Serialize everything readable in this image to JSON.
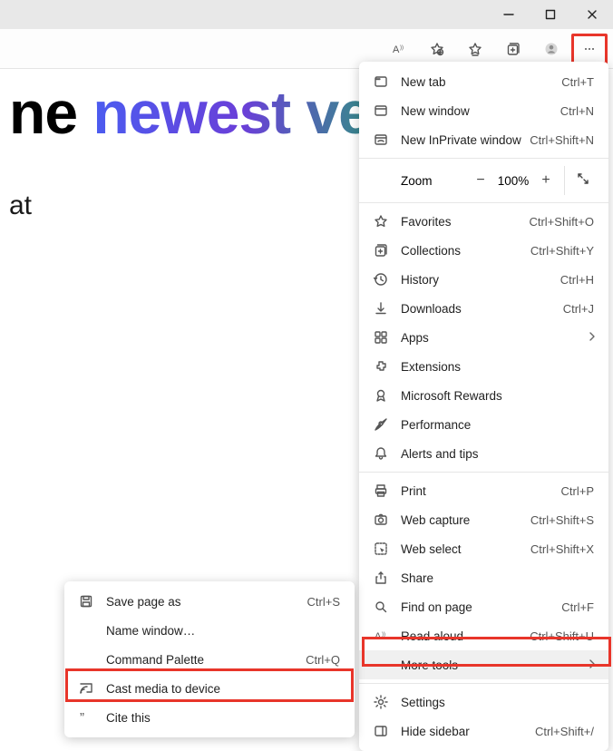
{
  "window": {
    "min": "−",
    "max": "▢",
    "close": "✕"
  },
  "page": {
    "headline_plain": "ne ",
    "headline_grad": "newest ver",
    "sub": "at"
  },
  "menu": {
    "items": [
      {
        "label": "New tab",
        "shortcut": "Ctrl+T",
        "icon": "tab"
      },
      {
        "label": "New window",
        "shortcut": "Ctrl+N",
        "icon": "window"
      },
      {
        "label": "New InPrivate window",
        "shortcut": "Ctrl+Shift+N",
        "icon": "inprivate"
      },
      {
        "sep": true
      },
      {
        "zoom": true,
        "label": "Zoom",
        "value": "100%"
      },
      {
        "sep": true
      },
      {
        "label": "Favorites",
        "shortcut": "Ctrl+Shift+O",
        "icon": "star"
      },
      {
        "label": "Collections",
        "shortcut": "Ctrl+Shift+Y",
        "icon": "collections"
      },
      {
        "label": "History",
        "shortcut": "Ctrl+H",
        "icon": "history"
      },
      {
        "label": "Downloads",
        "shortcut": "Ctrl+J",
        "icon": "download"
      },
      {
        "label": "Apps",
        "icon": "apps",
        "sub": true
      },
      {
        "label": "Extensions",
        "icon": "extensions"
      },
      {
        "label": "Microsoft Rewards",
        "icon": "rewards"
      },
      {
        "label": "Performance",
        "icon": "performance"
      },
      {
        "label": "Alerts and tips",
        "icon": "bell"
      },
      {
        "sep": true
      },
      {
        "label": "Print",
        "shortcut": "Ctrl+P",
        "icon": "print"
      },
      {
        "label": "Web capture",
        "shortcut": "Ctrl+Shift+S",
        "icon": "capture"
      },
      {
        "label": "Web select",
        "shortcut": "Ctrl+Shift+X",
        "icon": "select"
      },
      {
        "label": "Share",
        "icon": "share"
      },
      {
        "label": "Find on page",
        "shortcut": "Ctrl+F",
        "icon": "find"
      },
      {
        "label": "Read aloud",
        "shortcut": "Ctrl+Shift+U",
        "icon": "read"
      },
      {
        "label": "More tools",
        "icon": "",
        "sub": true,
        "selected": true
      },
      {
        "sep": true
      },
      {
        "label": "Settings",
        "icon": "settings"
      },
      {
        "label": "Hide sidebar",
        "shortcut": "Ctrl+Shift+/",
        "icon": "sidebar"
      }
    ]
  },
  "submenu": {
    "items": [
      {
        "label": "Save page as",
        "shortcut": "Ctrl+S",
        "icon": "save"
      },
      {
        "label": "Name window…",
        "icon": ""
      },
      {
        "label": "Command Palette",
        "shortcut": "Ctrl+Q",
        "icon": ""
      },
      {
        "label": "Cast media to device",
        "icon": "cast"
      },
      {
        "label": "Cite this",
        "icon": "cite"
      }
    ]
  }
}
